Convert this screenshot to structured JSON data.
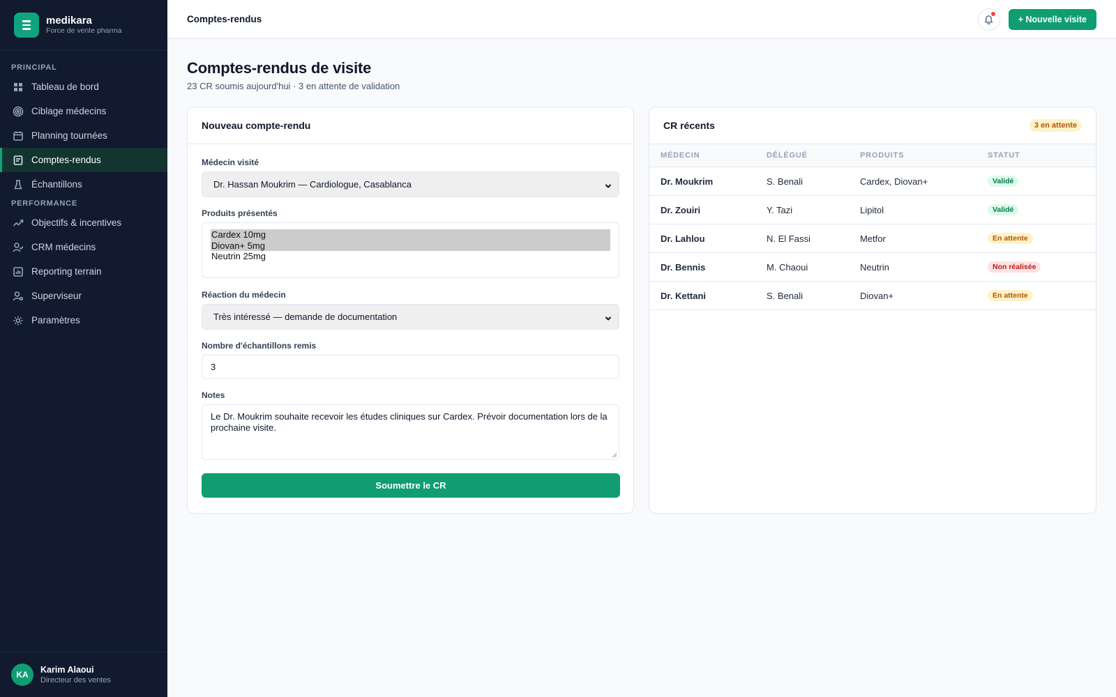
{
  "brand": {
    "name": "medikara",
    "tagline": "Force de vente pharma"
  },
  "sidebar": {
    "sections": [
      {
        "label": "PRINCIPAL"
      },
      {
        "label": "PERFORMANCE"
      }
    ],
    "items": [
      {
        "label": "Tableau de bord",
        "icon": "grid-icon"
      },
      {
        "label": "Ciblage médecins",
        "icon": "target-icon"
      },
      {
        "label": "Planning tournées",
        "icon": "calendar-icon"
      },
      {
        "label": "Comptes-rendus",
        "icon": "document-icon",
        "active": true
      },
      {
        "label": "Échantillons",
        "icon": "flask-icon"
      },
      {
        "label": "Objectifs & incentives",
        "icon": "trend-icon"
      },
      {
        "label": "CRM médecins",
        "icon": "user-check-icon"
      },
      {
        "label": "Reporting terrain",
        "icon": "bar-chart-icon"
      },
      {
        "label": "Superviseur",
        "icon": "user-gear-icon"
      },
      {
        "label": "Paramètres",
        "icon": "gear-icon"
      }
    ]
  },
  "user": {
    "initials": "KA",
    "name": "Karim Alaoui",
    "role": "Directeur des ventes"
  },
  "topbar": {
    "title": "Comptes-rendus",
    "new_visit_label": "+ Nouvelle visite"
  },
  "page": {
    "title": "Comptes-rendus de visite",
    "subtitle": "23 CR soumis aujourd'hui · 3 en attente de validation"
  },
  "form": {
    "title": "Nouveau compte-rendu",
    "doctor_label": "Médecin visité",
    "doctor_value": "Dr. Hassan Moukrim — Cardiologue, Casablanca",
    "products_label": "Produits présentés",
    "products": [
      {
        "name": "Cardex 10mg",
        "selected": true
      },
      {
        "name": "Diovan+ 5mg",
        "selected": true
      },
      {
        "name": "Neutrin 25mg",
        "selected": false
      }
    ],
    "reaction_label": "Réaction du médecin",
    "reaction_value": "Très intéressé — demande de documentation",
    "samples_label": "Nombre d'échantillons remis",
    "samples_value": "3",
    "notes_label": "Notes",
    "notes_value": "Le Dr. Moukrim souhaite recevoir les études cliniques sur Cardex. Prévoir documentation lors de la prochaine visite.",
    "submit_label": "Soumettre le CR"
  },
  "recent": {
    "title": "CR récents",
    "badge": "3 en attente",
    "columns": [
      "MÉDECIN",
      "DÉLÉGUÉ",
      "PRODUITS",
      "STATUT"
    ],
    "rows": [
      {
        "doctor": "Dr. Moukrim",
        "delegate": "S. Benali",
        "products": "Cardex, Diovan+",
        "status": "Validé",
        "status_type": "ok"
      },
      {
        "doctor": "Dr. Zouiri",
        "delegate": "Y. Tazi",
        "products": "Lipitol",
        "status": "Validé",
        "status_type": "ok"
      },
      {
        "doctor": "Dr. Lahlou",
        "delegate": "N. El Fassi",
        "products": "Metfor",
        "status": "En attente",
        "status_type": "wait"
      },
      {
        "doctor": "Dr. Bennis",
        "delegate": "M. Chaoui",
        "products": "Neutrin",
        "status": "Non réalisée",
        "status_type": "no"
      },
      {
        "doctor": "Dr. Kettani",
        "delegate": "S. Benali",
        "products": "Diovan+",
        "status": "En attente",
        "status_type": "wait"
      }
    ]
  },
  "colors": {
    "accent": "#0f9d71",
    "sidebar_bg": "#111a2e",
    "danger": "#ef4444"
  }
}
